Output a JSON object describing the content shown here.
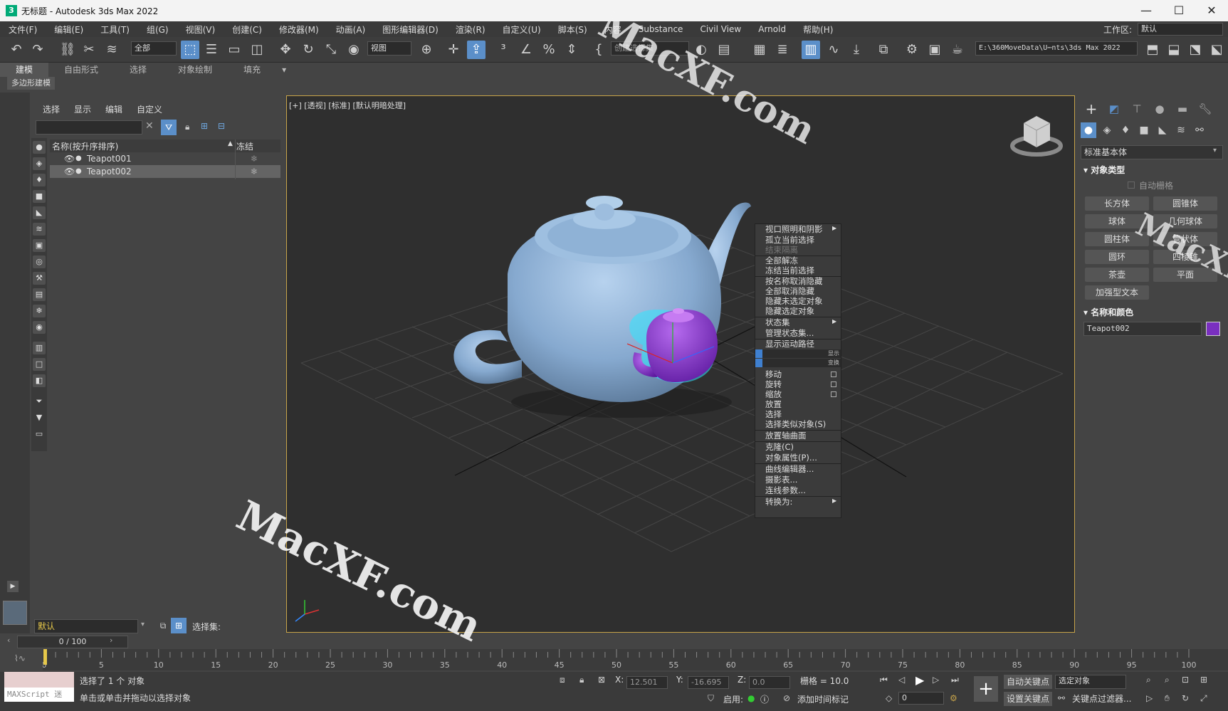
{
  "window": {
    "title": "无标题 - Autodesk 3ds Max 2022",
    "minimize": "—",
    "maximize": "☐",
    "close": "✕"
  },
  "menu": [
    "文件(F)",
    "编辑(E)",
    "工具(T)",
    "组(G)",
    "视图(V)",
    "创建(C)",
    "修改器(M)",
    "动画(A)",
    "图形编辑器(D)",
    "渲染(R)",
    "自定义(U)",
    "脚本(S)",
    "内容",
    "Substance",
    "Civil View",
    "Arnold",
    "帮助(H)"
  ],
  "workspace": {
    "label": "工作区:",
    "value": "默认"
  },
  "toolbar": {
    "filter_value": "全部",
    "refcoord_value": "视图",
    "selset_placeholder": "创建选择集",
    "project_path": "E:\\360MoveData\\U⋯nts\\3ds Max 2022"
  },
  "ribbon": {
    "tabs": [
      "建模",
      "自由形式",
      "选择",
      "对象绘制",
      "填充"
    ],
    "sub_label": "多边形建模"
  },
  "explorer": {
    "tabs": [
      "选择",
      "显示",
      "编辑",
      "自定义"
    ],
    "col_name": "名称(按升序排序)",
    "col_freeze": "冻结",
    "rows": [
      {
        "name": "Teapot001"
      },
      {
        "name": "Teapot002"
      }
    ],
    "layer_value": "默认",
    "selset_label": "选择集:"
  },
  "viewport": {
    "label": "[+] [透视] [标准] [默认明暗处理]"
  },
  "context_menu": {
    "items": [
      "视口照明和阴影",
      "孤立当前选择",
      "结束隔离",
      "全部解冻",
      "冻结当前选择",
      "按名称取消隐藏",
      "全部取消隐藏",
      "隐藏未选定对象",
      "隐藏选定对象",
      "状态集",
      "管理状态集...",
      "显示运动路径",
      "移动",
      "旋转",
      "缩放",
      "放置",
      "选择",
      "选择类似对象(S)",
      "放置轴曲面",
      "克隆(C)",
      "对象属性(P)...",
      "曲线编辑器...",
      "摄影表...",
      "连线参数...",
      "转换为:"
    ],
    "quad_labels": [
      "显示",
      "变换"
    ]
  },
  "command_panel": {
    "dropdown": "标准基本体",
    "rollout_object_type": "对象类型",
    "autogrid": "自动栅格",
    "buttons": [
      "长方体",
      "圆锥体",
      "球体",
      "几何球体",
      "圆柱体",
      "管状体",
      "圆环",
      "四棱锥",
      "茶壶",
      "平面",
      "加强型文本"
    ],
    "rollout_name_color": "名称和颜色",
    "object_name": "Teapot002",
    "object_color": "#7a2fc0"
  },
  "timeline": {
    "slider_text": "0 / 100",
    "ticks": [
      "0",
      "5",
      "10",
      "15",
      "20",
      "25",
      "30",
      "35",
      "40",
      "45",
      "50",
      "55",
      "60",
      "65",
      "70",
      "75",
      "80",
      "85",
      "90",
      "95",
      "100"
    ]
  },
  "status": {
    "maxscript": "MAXScript 迷",
    "selected": "选择了 1 个 对象",
    "prompt": "单击或单击并拖动以选择对象",
    "x_label": "X:",
    "x_value": "12.501",
    "y_label": "Y:",
    "y_value": "-16.695",
    "z_label": "Z:",
    "z_value": "0.0",
    "grid": "栅格 = 10.0",
    "enable": "启用:",
    "add_time_tag": "添加时间标记",
    "auto_key": "自动关键点",
    "set_key": "设置关键点",
    "key_mode_value": "选定对象",
    "key_filters": "关键点过滤器...",
    "frame_value": "0"
  },
  "watermark": "MacXF.com"
}
